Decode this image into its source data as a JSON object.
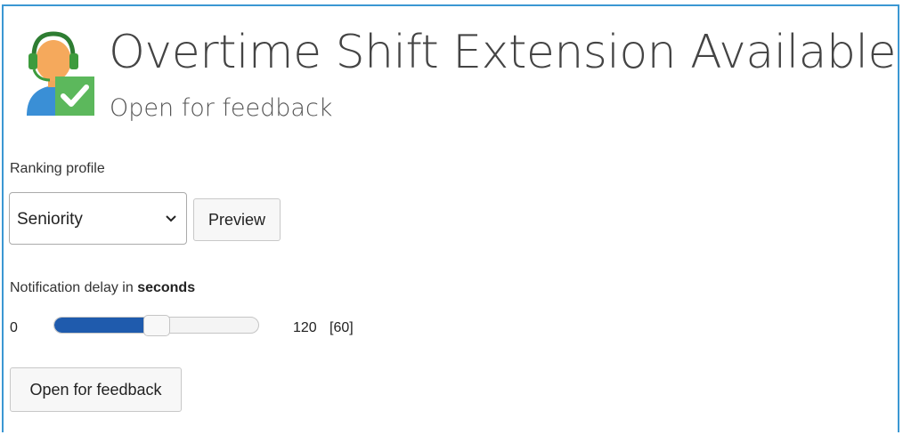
{
  "header": {
    "title": "Overtime Shift Extension Available",
    "subtitle": "Open for feedback",
    "avatar_icon": "agent-headset-check-icon"
  },
  "ranking": {
    "label": "Ranking profile",
    "selected": "Seniority",
    "preview_label": "Preview"
  },
  "delay": {
    "label_prefix": "Notification delay in ",
    "label_unit": "seconds",
    "min": "0",
    "max": "120",
    "current": "[60]",
    "value": 60,
    "range": [
      0,
      120
    ]
  },
  "actions": {
    "open_label": "Open for feedback"
  },
  "colors": {
    "frame_border": "#3b97d3",
    "slider_fill": "#1f5bad",
    "check_green": "#5cb85c"
  }
}
